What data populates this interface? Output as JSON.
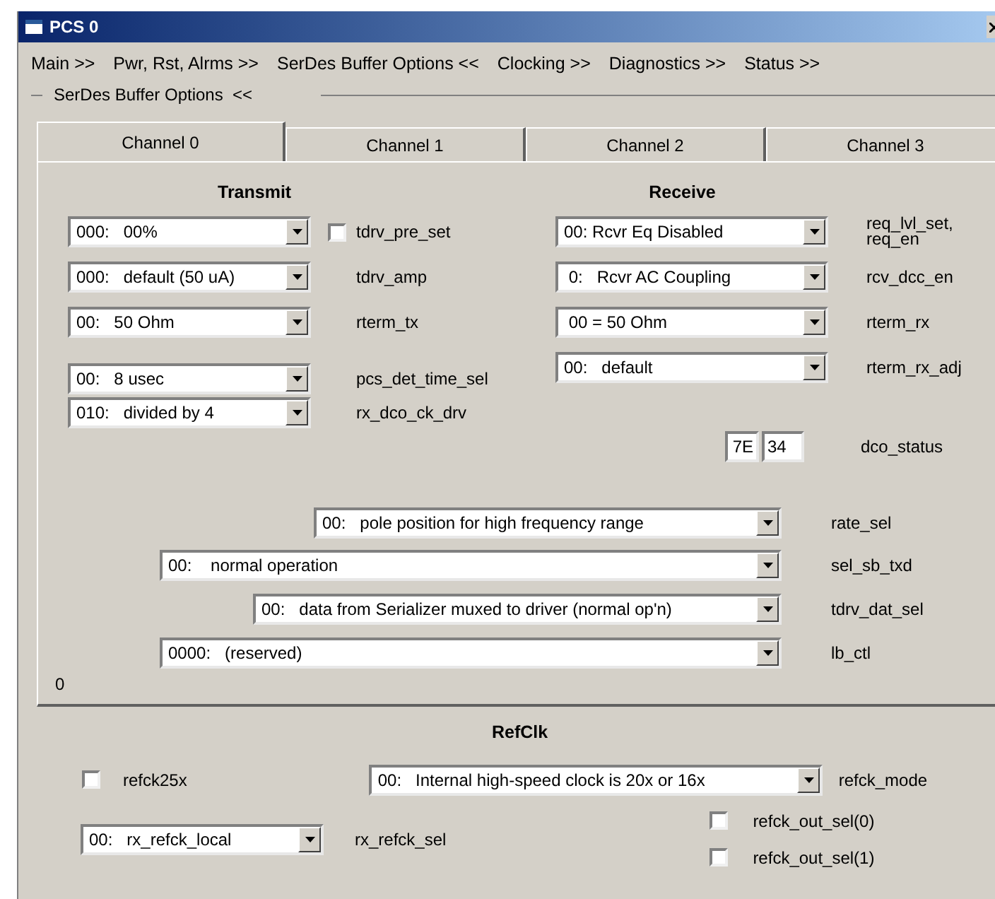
{
  "window": {
    "title": "PCS 0"
  },
  "menu": [
    {
      "label": "Main >>"
    },
    {
      "label": "Pwr, Rst, Alrms >>"
    },
    {
      "label": "SerDes Buffer Options <<"
    },
    {
      "label": "Clocking >>"
    },
    {
      "label": "Diagnostics >>"
    },
    {
      "label": "Status >>"
    }
  ],
  "group": {
    "label": "SerDes Buffer Options  <<"
  },
  "tabs": [
    {
      "label": "Channel 0",
      "selected": true
    },
    {
      "label": "Channel 1",
      "selected": false
    },
    {
      "label": "Channel 2",
      "selected": false
    },
    {
      "label": "Channel 3",
      "selected": false
    }
  ],
  "transmit": {
    "heading": "Transmit",
    "rows": [
      {
        "kind": "combo_checkbox",
        "value": "000:   00%",
        "label": "tdrv_pre_set",
        "checked": false
      },
      {
        "kind": "combo",
        "value": "000:   default (50 uA)",
        "label": "tdrv_amp"
      },
      {
        "kind": "combo",
        "value": "00:   50 Ohm",
        "label": "rterm_tx"
      },
      {
        "kind": "combo",
        "value": "00:   8 usec",
        "label": "pcs_det_time_sel"
      },
      {
        "kind": "combo",
        "value": "010:   divided by 4",
        "label": "rx_dco_ck_drv"
      }
    ]
  },
  "receive": {
    "heading": "Receive",
    "rows": [
      {
        "value": "00: Rcvr Eq Disabled",
        "label": "req_lvl_set, req_en"
      },
      {
        "value": " 0:   Rcvr AC Coupling",
        "label": "rcv_dcc_en"
      },
      {
        "value": " 00 = 50 Ohm",
        "label": "rterm_rx"
      },
      {
        "value": "00:   default",
        "label": "rterm_rx_adj"
      }
    ]
  },
  "dco_status": {
    "values": [
      "7E",
      "34"
    ],
    "label": "dco_status"
  },
  "wide_rows": [
    {
      "value": "00:   pole position for high frequency range",
      "label": "rate_sel"
    },
    {
      "value": "00:    normal operation",
      "label": "sel_sb_txd"
    },
    {
      "value": "00:   data from Serializer muxed to driver (normal op'n)",
      "label": "tdrv_dat_sel"
    },
    {
      "value": "0000:   (reserved)",
      "label": "lb_ctl"
    }
  ],
  "corner_value": "0",
  "refclk": {
    "heading": "RefClk",
    "refck25x": {
      "label": "refck25x",
      "checked": false
    },
    "refck_mode": {
      "value": "00:   Internal high-speed clock is 20x or 16x",
      "label": "refck_mode"
    },
    "rx_refck_sel": {
      "value": "00:   rx_refck_local",
      "label": "rx_refck_sel"
    },
    "out_sel": [
      {
        "label": "refck_out_sel(0)",
        "checked": false
      },
      {
        "label": "refck_out_sel(1)",
        "checked": false
      }
    ]
  }
}
